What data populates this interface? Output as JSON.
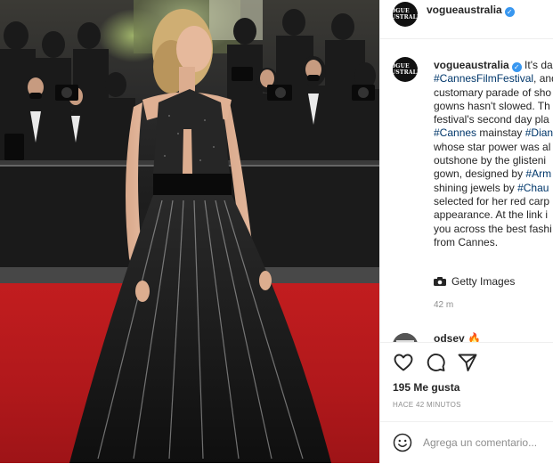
{
  "account": {
    "username": "vogueaustralia",
    "avatar_text": "VOGUE AUSTRALIA",
    "verified": true
  },
  "caption": {
    "lines": [
      {
        "parts": [
          {
            "t": "It's da",
            "tag": false
          }
        ]
      },
      {
        "parts": [
          {
            "t": "#CannesFilmFestival",
            "tag": true
          },
          {
            "t": ", and",
            "tag": false
          }
        ]
      },
      {
        "parts": [
          {
            "t": "customary parade of sho",
            "tag": false
          }
        ]
      },
      {
        "parts": [
          {
            "t": "gowns hasn't slowed. Th",
            "tag": false
          }
        ]
      },
      {
        "parts": [
          {
            "t": "festival's second day pla",
            "tag": false
          }
        ]
      },
      {
        "parts": [
          {
            "t": "#Cannes",
            "tag": true
          },
          {
            "t": " mainstay ",
            "tag": false
          },
          {
            "t": "#Dian",
            "tag": true
          }
        ]
      },
      {
        "parts": [
          {
            "t": "whose star power was al",
            "tag": false
          }
        ]
      },
      {
        "parts": [
          {
            "t": "outshone by the glisteni",
            "tag": false
          }
        ]
      },
      {
        "parts": [
          {
            "t": "gown, designed by ",
            "tag": false
          },
          {
            "t": "#Arm",
            "tag": true
          }
        ]
      },
      {
        "parts": [
          {
            "t": "shining jewels by ",
            "tag": false
          },
          {
            "t": "#Chau",
            "tag": true
          }
        ]
      },
      {
        "parts": [
          {
            "t": "selected for her red carp",
            "tag": false
          }
        ]
      },
      {
        "parts": [
          {
            "t": "appearance. At the link i",
            "tag": false
          }
        ]
      },
      {
        "parts": [
          {
            "t": "you across the best fashi",
            "tag": false
          }
        ]
      },
      {
        "parts": [
          {
            "t": "from Cannes.",
            "tag": false
          }
        ]
      }
    ],
    "credit": "Getty Images",
    "time": "42 m"
  },
  "reply": {
    "username": "odsey"
  },
  "actions": {
    "likes": "195 Me gusta",
    "posted_ago": "HACE 42 MINUTOS"
  },
  "comment": {
    "placeholder": "Agrega un comentario..."
  },
  "colors": {
    "link": "#00376b",
    "verified": "#3897f0",
    "carpet": "#c21d1f",
    "muted": "#8e8e8e"
  }
}
